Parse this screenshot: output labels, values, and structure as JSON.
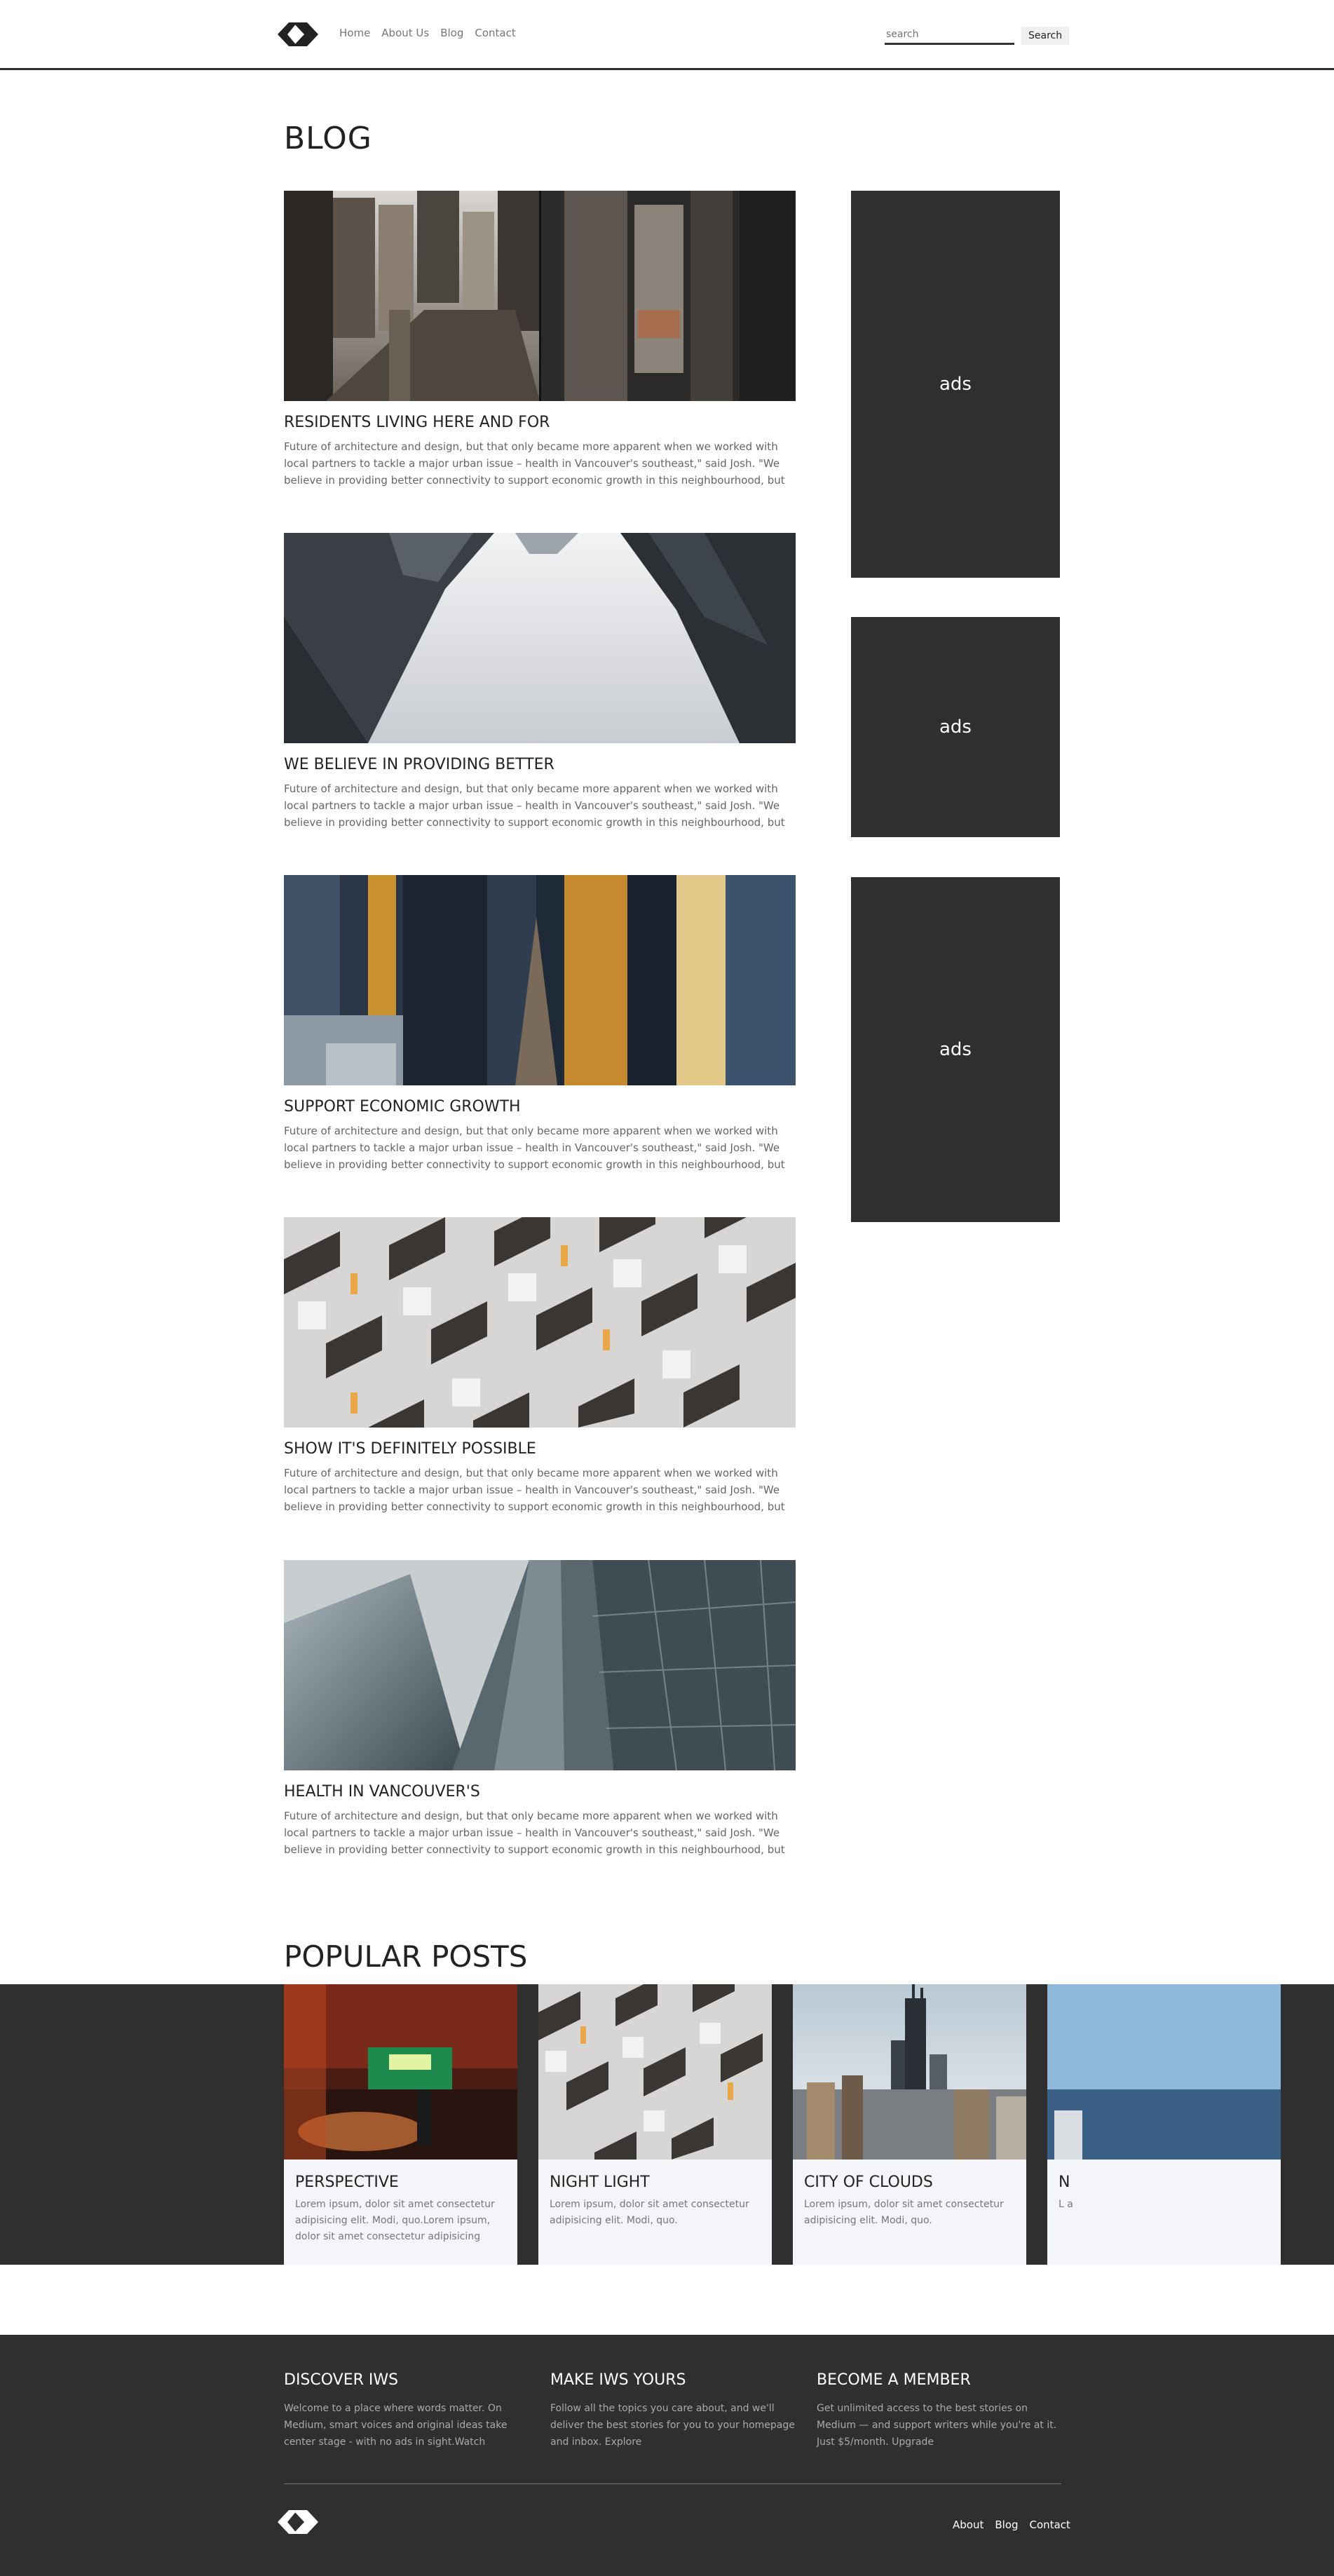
{
  "header": {
    "nav": [
      "Home",
      "About Us",
      "Blog",
      "Contact"
    ],
    "search_placeholder": "search",
    "search_button": "Search"
  },
  "page_title": "BLOG",
  "posts": [
    {
      "title": "RESIDENTS LIVING HERE AND FOR",
      "excerpt": "Future of architecture and design, but that only became more apparent when we worked with local partners to tackle a major urban issue – health in Vancouver's southeast,\" said Josh. \"We believe in providing better connectivity to support economic growth in this neighbourhood, but to provide som..."
    },
    {
      "title": "WE BELIEVE IN PROVIDING BETTER",
      "excerpt": "Future of architecture and design, but that only became more apparent when we worked with local partners to tackle a major urban issue – health in Vancouver's southeast,\" said Josh. \"We believe in providing better connectivity to support economic growth in this neighbourhood, but to provide som..."
    },
    {
      "title": "SUPPORT ECONOMIC GROWTH",
      "excerpt": "Future of architecture and design, but that only became more apparent when we worked with local partners to tackle a major urban issue – health in Vancouver's southeast,\" said Josh. \"We believe in providing better connectivity to support economic growth in this neighbourhood, but to provide som..."
    },
    {
      "title": "SHOW IT'S DEFINITELY POSSIBLE",
      "excerpt": "Future of architecture and design, but that only became more apparent when we worked with local partners to tackle a major urban issue – health in Vancouver's southeast,\" said Josh. \"We believe in providing better connectivity to support economic growth in this neighbourhood, but to provide som..."
    },
    {
      "title": "HEALTH IN VANCOUVER'S",
      "excerpt": "Future of architecture and design, but that only became more apparent when we worked with local partners to tackle a major urban issue – health in Vancouver's southeast,\" said Josh. \"We believe in providing better connectivity to support economic growth in this neighbourhood, but to provide som..."
    }
  ],
  "ads": [
    "ads",
    "ads",
    "ads"
  ],
  "popular_title": "POPULAR POSTS",
  "popular": [
    {
      "title": "PERSPECTIVE",
      "text": "Lorem ipsum, dolor sit amet consectetur adipisicing elit. Modi, quo.Lorem ipsum, dolor sit amet consectetur adipisicing elit...."
    },
    {
      "title": "NIGHT LIGHT",
      "text": "Lorem ipsum, dolor sit amet consectetur adipisicing elit. Modi, quo."
    },
    {
      "title": "CITY OF CLOUDS",
      "text": "Lorem ipsum, dolor sit amet consectetur adipisicing elit. Modi, quo."
    },
    {
      "title": "N",
      "text": "L a"
    }
  ],
  "footer": {
    "columns": [
      {
        "title": "DISCOVER IWS",
        "text": "Welcome to a place where words matter. On Medium, smart voices and original ideas take center stage - with no ads in sight.Watch"
      },
      {
        "title": "MAKE IWS YOURS",
        "text": "Follow all the topics you care about, and we'll deliver the best stories for you to your homepage and inbox. Explore"
      },
      {
        "title": "BECOME A MEMBER",
        "text": "Get unlimited access to the best stories on Medium — and support writers while you're at it. Just $5/month. Upgrade"
      }
    ],
    "links": [
      "About",
      "Blog",
      "Contact"
    ]
  }
}
